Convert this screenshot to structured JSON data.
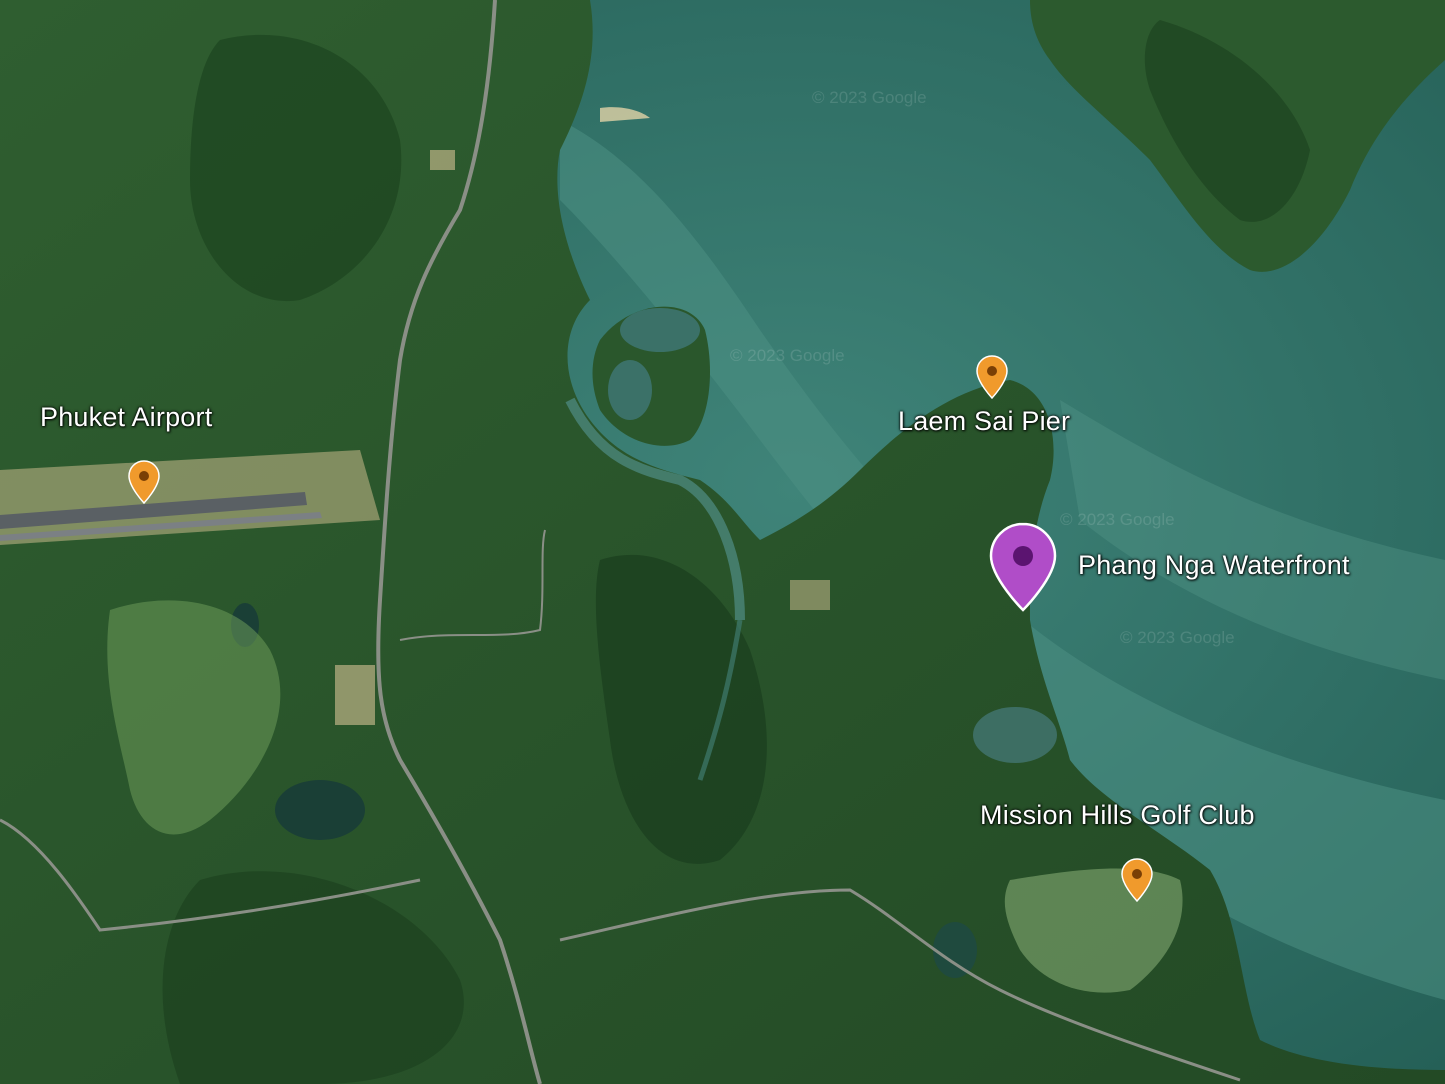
{
  "map": {
    "type": "satellite",
    "colors": {
      "sea": "#2c6e63",
      "sea_light": "#4f8f84",
      "sea_deep": "#1e5a52",
      "land": "#2d5a2e",
      "land_dark": "#1c3f20",
      "lagoon": "#3c7268",
      "runway": "#5c6266",
      "sand": "#d8c48e"
    },
    "watermark": "© 2023 Google"
  },
  "places": [
    {
      "id": "phuket-airport",
      "label": "Phuket Airport",
      "pin": "orange-pin-icon",
      "color": "#f09a2c"
    },
    {
      "id": "laem-sai-pier",
      "label": "Laem Sai Pier",
      "pin": "orange-pin-icon",
      "color": "#f09a2c"
    },
    {
      "id": "phang-nga-waterfront",
      "label": "Phang Nga Waterfront",
      "pin": "purple-pin-icon",
      "color": "#b04dc8"
    },
    {
      "id": "mission-hills-golf-club",
      "label": "Mission Hills Golf Club",
      "pin": "orange-pin-icon",
      "color": "#f09a2c"
    }
  ]
}
